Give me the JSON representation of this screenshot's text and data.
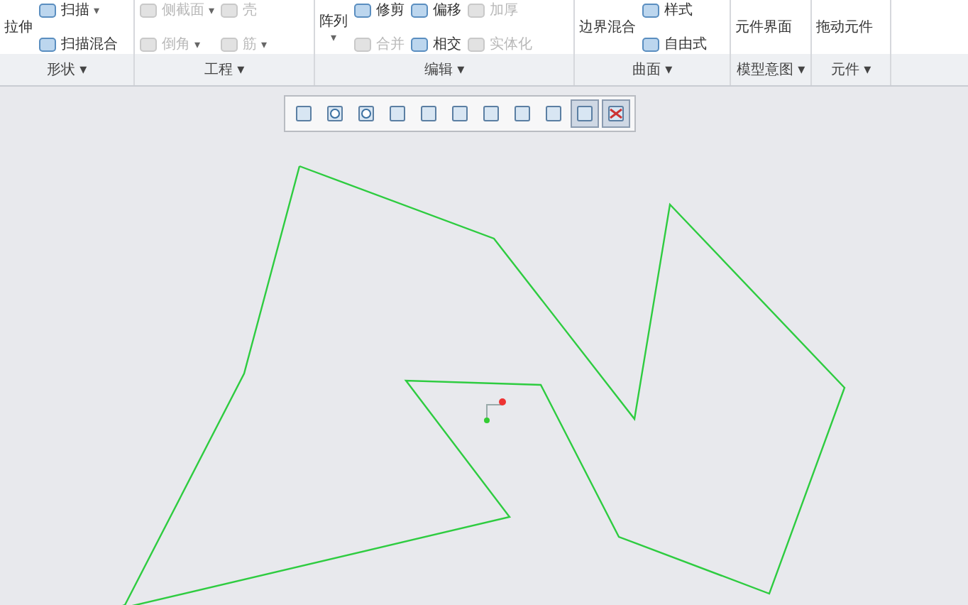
{
  "ribbon": {
    "groups": [
      {
        "label": "形状",
        "caret": "▾",
        "columns": [
          [
            {
              "kind": "large",
              "label": "拉伸",
              "disabled": false
            }
          ],
          [
            {
              "kind": "small",
              "label": "扫描",
              "disabled": false,
              "caret": "▾"
            },
            {
              "kind": "small",
              "label": "扫描混合",
              "disabled": false
            }
          ]
        ]
      },
      {
        "label": "工程",
        "caret": "▾",
        "columns": [
          [
            {
              "kind": "small",
              "label": "侧截面",
              "disabled": true,
              "caret": "▾"
            },
            {
              "kind": "small",
              "label": "倒角",
              "disabled": true,
              "caret": "▾"
            }
          ],
          [
            {
              "kind": "small",
              "label": "壳",
              "disabled": true
            },
            {
              "kind": "small",
              "label": "筋",
              "disabled": true,
              "caret": "▾"
            }
          ]
        ]
      },
      {
        "label": "编辑",
        "caret": "▾",
        "columns": [
          [
            {
              "kind": "large",
              "label": "阵列",
              "disabled": false,
              "caret": "▾"
            }
          ],
          [
            {
              "kind": "small",
              "label": "修剪",
              "disabled": false
            },
            {
              "kind": "small",
              "label": "合并",
              "disabled": true
            }
          ],
          [
            {
              "kind": "small",
              "label": "偏移",
              "disabled": false
            },
            {
              "kind": "small",
              "label": "相交",
              "disabled": false
            }
          ],
          [
            {
              "kind": "small",
              "label": "加厚",
              "disabled": true
            },
            {
              "kind": "small",
              "label": "实体化",
              "disabled": true
            }
          ]
        ]
      },
      {
        "label": "曲面",
        "caret": "▾",
        "columns": [
          [
            {
              "kind": "large",
              "label": "边界混合",
              "disabled": false
            }
          ],
          [
            {
              "kind": "small",
              "label": "样式",
              "disabled": false
            },
            {
              "kind": "small",
              "label": "自由式",
              "disabled": false
            }
          ]
        ]
      },
      {
        "label": "模型意图",
        "caret": "▾",
        "columns": [
          [
            {
              "kind": "large",
              "label": "元件界面",
              "disabled": false
            }
          ]
        ]
      },
      {
        "label": "元件",
        "caret": "▾",
        "columns": [
          [
            {
              "kind": "large",
              "label": "拖动元件",
              "disabled": false
            }
          ]
        ]
      }
    ]
  },
  "view_toolbar": [
    {
      "selected": false
    },
    {
      "selected": false
    },
    {
      "selected": false
    },
    {
      "selected": false
    },
    {
      "selected": false
    },
    {
      "selected": false
    },
    {
      "selected": false
    },
    {
      "selected": false
    },
    {
      "selected": false
    },
    {
      "selected": true
    },
    {
      "selected": true
    }
  ]
}
